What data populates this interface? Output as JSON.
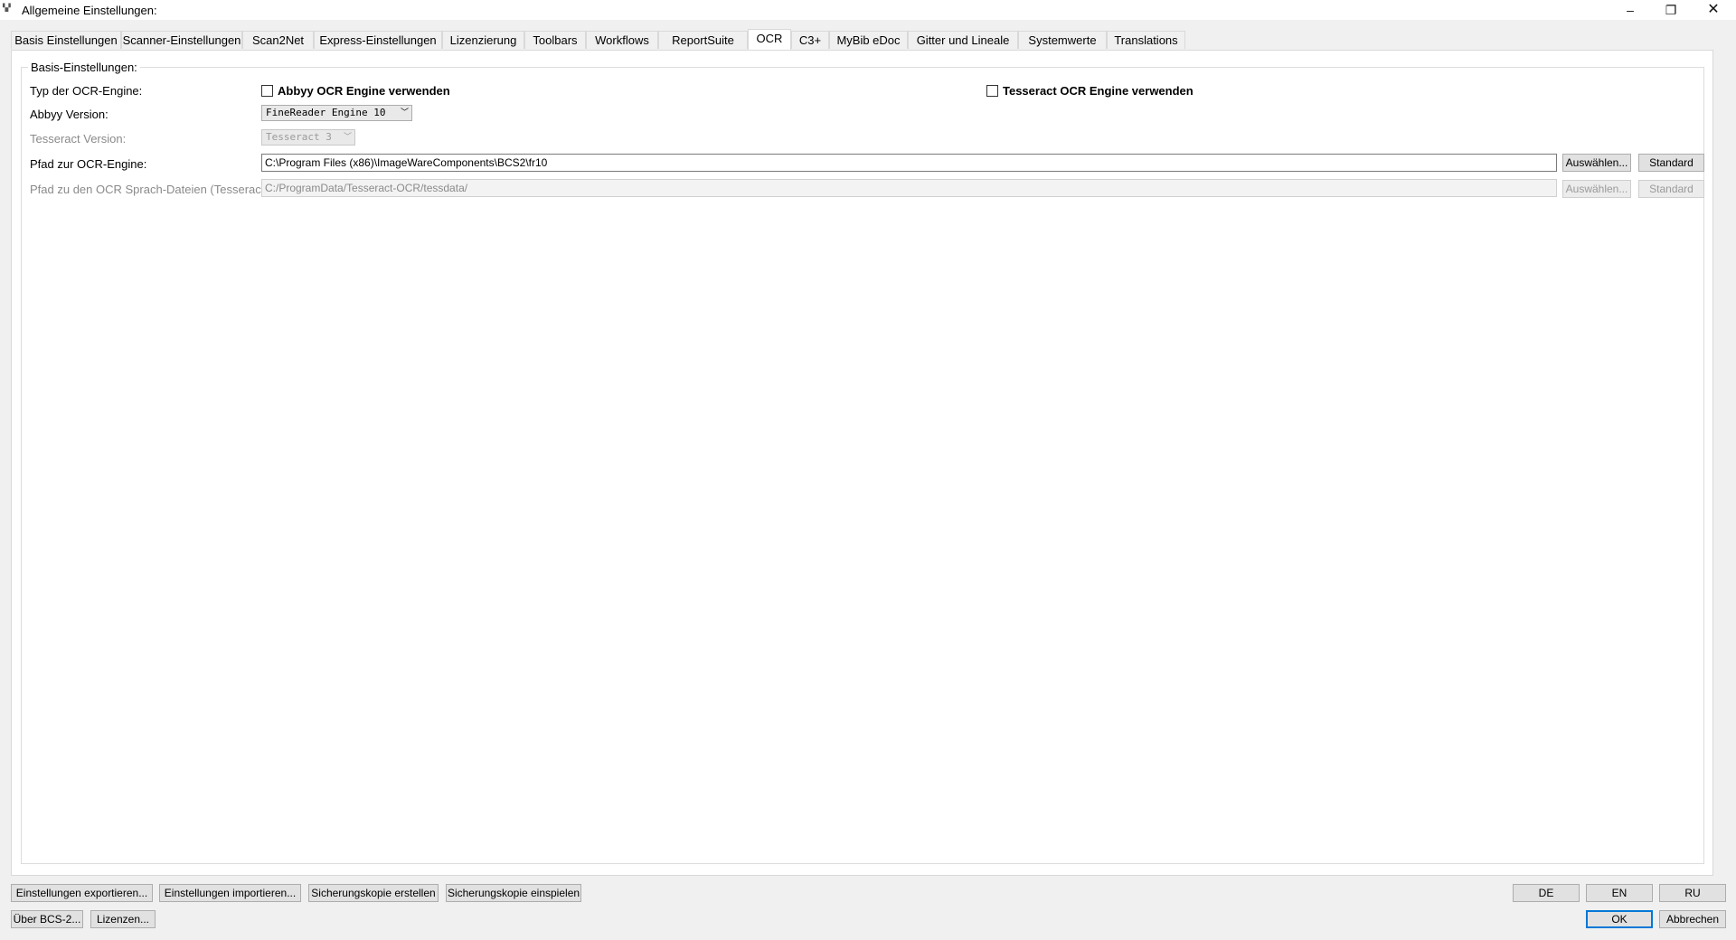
{
  "window": {
    "title": "Allgemeine Einstellungen:",
    "controls": {
      "minimize": "–",
      "maximize": "❐",
      "close": "✕"
    }
  },
  "tabs": [
    "Basis Einstellungen",
    "Scanner-Einstellungen",
    "Scan2Net",
    "Express-Einstellungen",
    "Lizenzierung",
    "Toolbars",
    "Workflows",
    "ReportSuite",
    "OCR",
    "C3+",
    "MyBib eDoc",
    "Gitter und Lineale",
    "Systemwerte",
    "Translations"
  ],
  "active_tab": "OCR",
  "ocr": {
    "group_title": "Basis-Einstellungen:",
    "engine_type_label": "Typ  der OCR-Engine:",
    "abbyy_checkbox": {
      "label": "Abbyy OCR Engine verwenden",
      "checked": false
    },
    "tesseract_checkbox": {
      "label": "Tesseract OCR Engine verwenden",
      "checked": false
    },
    "abbyy_version_label": "Abbyy Version:",
    "abbyy_version_value": "FineReader Engine 10",
    "tesseract_version_label": "Tesseract Version:",
    "tesseract_version_value": "Tesseract 3",
    "engine_path_label": "Pfad zur OCR-Engine:",
    "engine_path_value": "C:\\Program Files (x86)\\ImageWareComponents\\BCS2\\fr10",
    "lang_path_label": "Pfad zu den OCR Sprach-Dateien (Tesseract):",
    "lang_path_value": "C:/ProgramData/Tesseract-OCR/tessdata/",
    "browse_label": "Auswählen...",
    "default_label": "Standard"
  },
  "footer": {
    "export": "Einstellungen exportieren...",
    "import": "Einstellungen importieren...",
    "backup_create": "Sicherungskopie erstellen",
    "backup_restore": "Sicherungskopie einspielen",
    "about": "Über BCS-2...",
    "licenses": "Lizenzen...",
    "lang_de": "DE",
    "lang_en": "EN",
    "lang_ru": "RU",
    "ok": "OK",
    "cancel": "Abbrechen"
  },
  "colors": {
    "accent": "#0078d7",
    "background": "#f0f0f0",
    "panel": "#ffffff"
  }
}
